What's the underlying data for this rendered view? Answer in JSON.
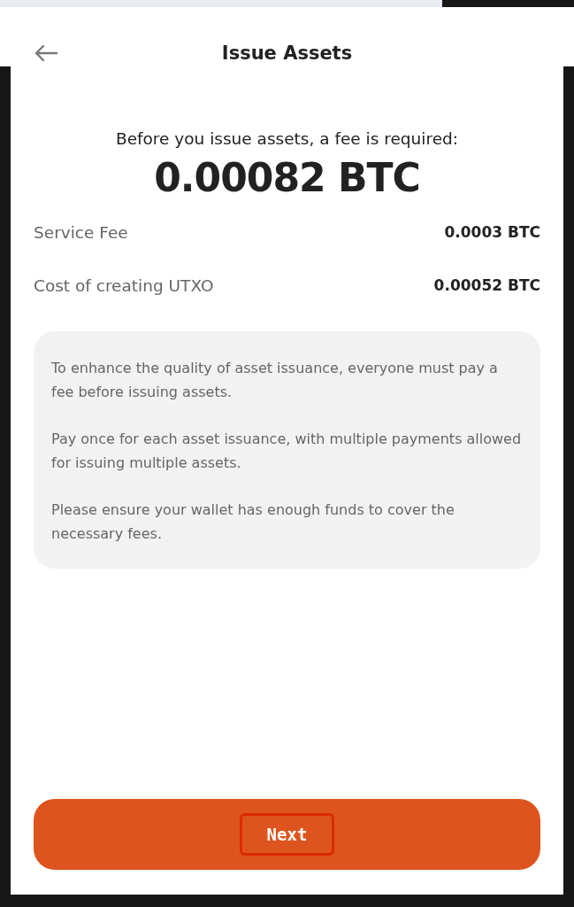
{
  "header": {
    "title": "Issue Assets"
  },
  "fee": {
    "prompt": "Before you issue assets, a fee is required:",
    "amount": "0.00082 BTC"
  },
  "fee_rows": [
    {
      "label": "Service Fee",
      "value": "0.0003 BTC"
    },
    {
      "label": "Cost of creating UTXO",
      "value": "0.00052 BTC"
    }
  ],
  "notes": [
    "To enhance the quality of asset issuance, everyone must pay a fee before issuing assets.",
    "Pay once for each asset issuance, with multiple payments allowed for issuing multiple assets.",
    "Please ensure your wallet has enough funds to cover the necessary fees."
  ],
  "next_button": {
    "label": "Next",
    "focused": true
  }
}
